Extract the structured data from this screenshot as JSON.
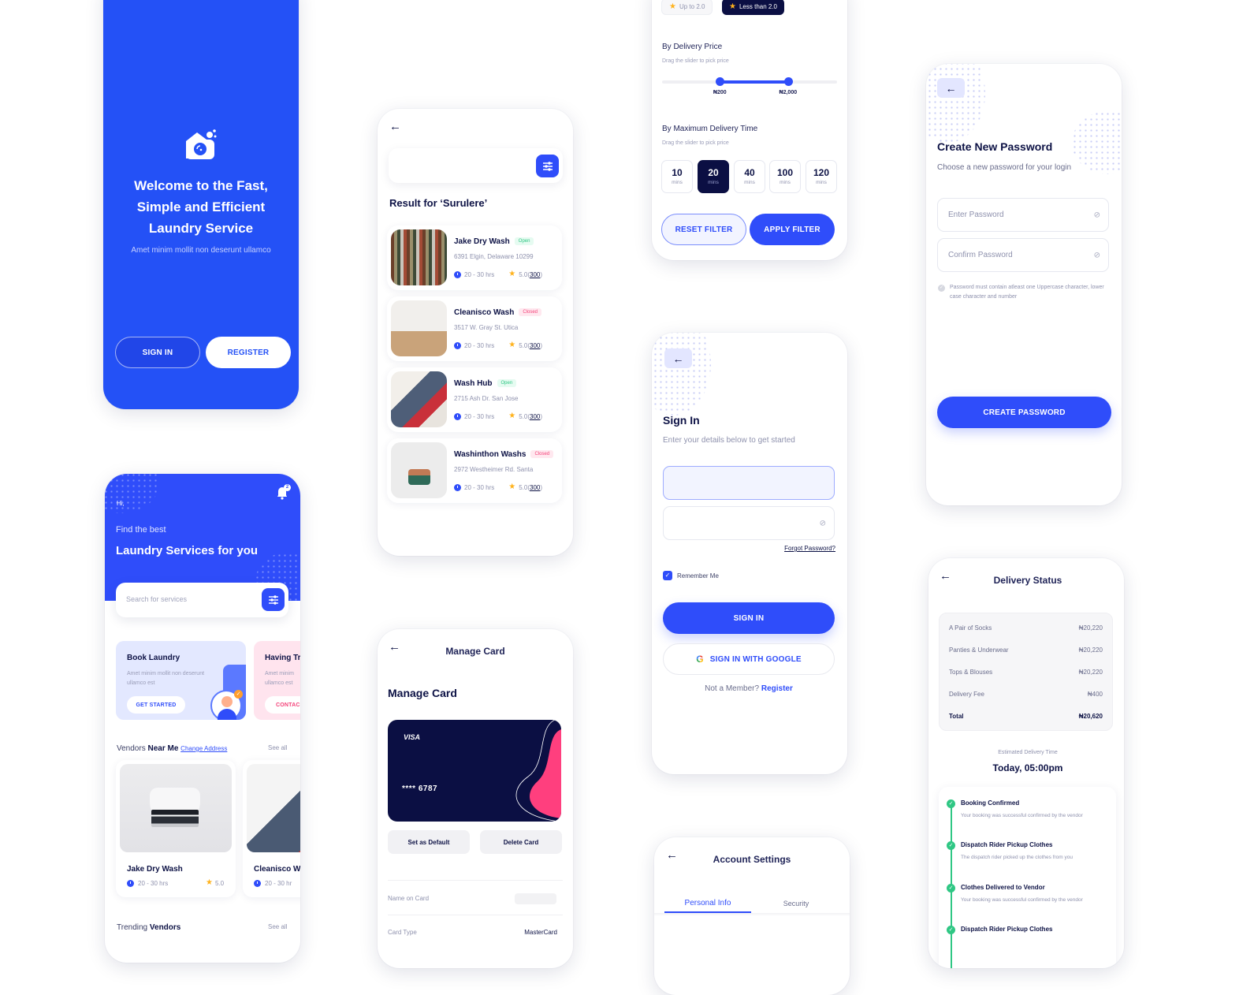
{
  "welcome": {
    "title_lines": [
      "Welcome to the Fast,",
      "Simple and Efficient",
      "Laundry Service"
    ],
    "subtitle": "Amet minim mollit non deserunt ullamco",
    "sign_in_label": "SIGN IN",
    "register_label": "REGISTER",
    "brand_color": "#2f4dfa"
  },
  "home": {
    "greeting": "Hi,",
    "notification_count": "2",
    "find_text": "Find the best",
    "headline": "Laundry Services for you",
    "search_placeholder": "Search for services",
    "promos": [
      {
        "title": "Book Laundry",
        "desc": "Amet minim mollit non deserunt ullamco est",
        "button": "GET STARTED"
      },
      {
        "title": "Having Tr",
        "desc": "Amet minim ullamco est",
        "button": "CONTAC"
      }
    ],
    "vendors_section": {
      "title_light": "Vendors",
      "title_bold": "Near Me",
      "change_address": "Change Address",
      "see_all": "See all"
    },
    "vendors": [
      {
        "name": "Jake Dry Wash",
        "time": "20 - 30 hrs",
        "rating": "5.0"
      },
      {
        "name": "Cleanisco Wa",
        "time": "20 - 30 hr"
      }
    ],
    "trending_section": {
      "title_light": "Trending",
      "title_bold": "Vendors",
      "see_all": "See all"
    }
  },
  "search": {
    "result_title": "Result for ‘Surulere’",
    "results": [
      {
        "name": "Jake Dry Wash",
        "status": "Open",
        "address": "6391 Elgin, Delaware 10299",
        "time": "20 - 30 hrs",
        "rating": "5.0",
        "reviews": "300"
      },
      {
        "name": "Cleanisco Wash",
        "status": "Closed",
        "address": "3517 W. Gray St. Utica",
        "time": "20 - 30 hrs",
        "rating": "5.0",
        "reviews": "300"
      },
      {
        "name": "Wash Hub",
        "status": "Open",
        "address": "2715 Ash Dr. San Jose",
        "time": "20 - 30 hrs",
        "rating": "5.0",
        "reviews": "300"
      },
      {
        "name": "Washinthon Washs",
        "status": "Closed",
        "address": "2972 Westheimer Rd. Santa",
        "time": "20 - 30 hrs",
        "rating": "5.0",
        "reviews": "300"
      }
    ]
  },
  "card": {
    "header_title": "Manage Card",
    "page_title": "Manage Card",
    "brand": "VISA",
    "number": "**** 6787",
    "set_default": "Set as Default",
    "delete": "Delete Card",
    "fields": [
      {
        "label": "Name on Card",
        "value": ""
      },
      {
        "label": "Card Type",
        "value": "MasterCard"
      }
    ]
  },
  "filter": {
    "rating_chips": [
      {
        "label": "Up to 2.0",
        "selected": false
      },
      {
        "label": "Less than 2.0",
        "selected": true
      }
    ],
    "price": {
      "title": "By Delivery Price",
      "hint": "Drag the slider to pick price",
      "min_label": "₦200",
      "max_label": "₦2,000",
      "low_fraction": 0.33,
      "high_fraction": 0.72
    },
    "time": {
      "title": "By Maximum Delivery Time",
      "hint": "Drag the slider to pick price",
      "options": [
        {
          "value": "10",
          "unit": "mins"
        },
        {
          "value": "20",
          "unit": "mins",
          "selected": true
        },
        {
          "value": "40",
          "unit": "mins"
        },
        {
          "value": "100",
          "unit": "mins"
        },
        {
          "value": "120",
          "unit": "mins"
        }
      ]
    },
    "reset_label": "RESET FILTER",
    "apply_label": "APPLY FILTER"
  },
  "signin": {
    "title": "Sign In",
    "subtitle": "Enter your details below to get started",
    "email_value": "",
    "password_value": "",
    "forgot": "Forgot Password?",
    "remember": "Remember Me",
    "remember_checked": true,
    "signin_label": "SIGN IN",
    "google_label": "SIGN IN WITH GOOGLE",
    "not_member": "Not a Member?",
    "register": "Register"
  },
  "account": {
    "title": "Account Settings",
    "tabs": [
      {
        "label": "Personal Info",
        "active": true
      },
      {
        "label": "Security",
        "active": false
      }
    ]
  },
  "newpass": {
    "title": "Create New Password",
    "subtitle": "Choose a new password for your login",
    "enter_placeholder": "Enter Password",
    "confirm_placeholder": "Confirm Password",
    "rule": "Password must contain atleast one Uppercase character, lower case character and number",
    "button": "CREATE PASSWORD"
  },
  "delivery": {
    "title": "Delivery Status",
    "items": [
      {
        "label": "A Pair of Socks",
        "amount": "₦20,220"
      },
      {
        "label": "Panties & Underwear",
        "amount": "₦20,220"
      },
      {
        "label": "Tops & Blouses",
        "amount": "₦20,220"
      },
      {
        "label": "Delivery Fee",
        "amount": "₦400"
      }
    ],
    "total_label": "Total",
    "total_amount": "₦20,620",
    "eta_label": "Estimated Delivery Time",
    "eta_value": "Today, 05:00pm",
    "steps": [
      {
        "title": "Booking Confirmed",
        "desc": "Your booking was successful confirmed by the vendor"
      },
      {
        "title": "Dispatch Rider Pickup Clothes",
        "desc": "The dispatch rider picked up the clothes from you"
      },
      {
        "title": "Clothes Delivered to Vendor",
        "desc": "Your booking was successful confirmed by the vendor"
      },
      {
        "title": "Dispatch Rider Pickup Clothes",
        "desc": ""
      }
    ]
  }
}
